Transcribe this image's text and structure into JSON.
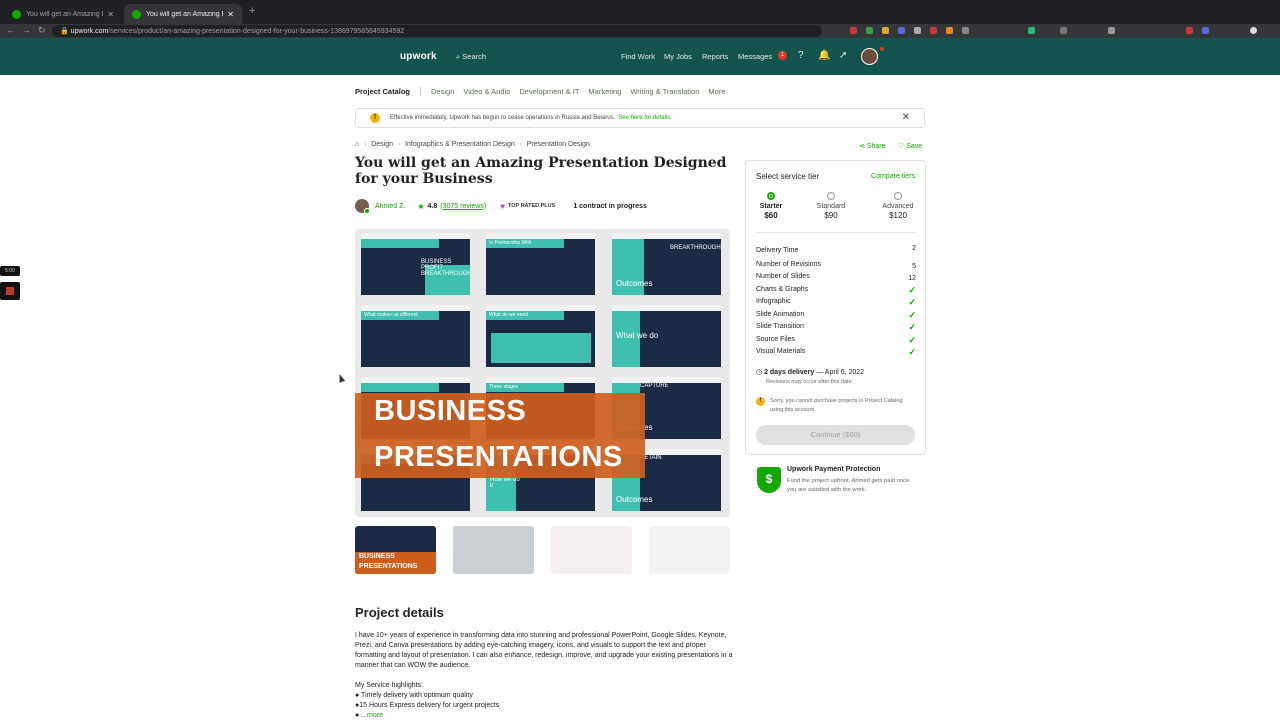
{
  "browser": {
    "tabs": [
      {
        "title": "You will get an Amazing Presentation"
      },
      {
        "title": "You will get an Amazing Presentation"
      }
    ],
    "url_domain": "upwork.com",
    "url_path": "/services/product/an-amazing-presentation-designed-for-your-business-1386979565645934592"
  },
  "header": {
    "logo": "upwork",
    "search": "Search",
    "nav": [
      "Find Work",
      "My Jobs",
      "Reports",
      "Messages"
    ],
    "messages_badge": "1"
  },
  "catnav": {
    "home": "Project Catalog",
    "items": [
      "Design",
      "Video & Audio",
      "Development & IT",
      "Marketing",
      "Writing & Translation",
      "More"
    ]
  },
  "alert": {
    "text": "Effective immediately, Upwork has begun to cease operations in Russia and Belarus.",
    "link": "See here for details."
  },
  "breadcrumb": [
    "Design",
    "Infographics & Presentation Design",
    "Presentation Design"
  ],
  "actions": {
    "share": "Share",
    "save": "Save"
  },
  "title": "You will get an Amazing Presentation Designed for your Business",
  "seller": {
    "name": "Ahmed Z.",
    "rating": "4.8",
    "reviews": "(3075 reviews)",
    "badge": "TOP RATED PLUS",
    "contracts": "1 contract in progress"
  },
  "gallery": {
    "overlay_line1": "BUSINESS",
    "overlay_line2": "PRESENTATIONS",
    "slides": [
      {
        "head": "",
        "caption": "BUSINESS PROFIT BREAKTHROUGH",
        "big": ""
      },
      {
        "head": "In Partnership With",
        "caption": "",
        "big": ""
      },
      {
        "head": "",
        "caption": "BREAKTHROUGH",
        "big": "Outcomes"
      },
      {
        "head": "What makes us different",
        "caption": "",
        "big": ""
      },
      {
        "head": "What do we need",
        "caption": "",
        "big": ""
      },
      {
        "head": "",
        "caption": "",
        "big": "What we do"
      },
      {
        "head": "",
        "caption": "",
        "big": ""
      },
      {
        "head": "Three stages",
        "caption": "",
        "big": ""
      },
      {
        "head": "CAPTURE",
        "caption": "",
        "big": "Outcomes"
      },
      {
        "head": "",
        "caption": "",
        "big": ""
      },
      {
        "head": "",
        "caption": "",
        "big": "How we do it"
      },
      {
        "head": "RETAIN",
        "caption": "",
        "big": "Outcomes"
      }
    ],
    "thumb_line1": "BUSINESS",
    "thumb_line2": "PRESENTATIONS"
  },
  "details": {
    "heading": "Project details",
    "body": "I have 10+ years of experience in transforming data into stunning and professional PowerPoint, Google Slides, Keynote, Prezi, and Canva presentations by adding eye-catching imagery, icons, and visuals to support the text and proper formatting and layout of presentation. I can also enhance, redesign, improve, and upgrade your existing presentations in a manner that can WOW the audience.",
    "highlights_title": "My Service highlights:",
    "highlights": [
      "● Timely delivery with optimum quality",
      "●15 Hours Express delivery for urgent projects",
      "● .."
    ],
    "more": "more"
  },
  "tiers_card": {
    "title": "Select service tier",
    "compare": "Compare tiers",
    "tiers": [
      {
        "name": "Starter",
        "price": "$60",
        "selected": true
      },
      {
        "name": "Standard",
        "price": "$90",
        "selected": false
      },
      {
        "name": "Advanced",
        "price": "$120",
        "selected": false
      }
    ],
    "features": [
      {
        "label": "Delivery Time",
        "value": "2"
      },
      {
        "label": "Number of Revisions",
        "value": "5"
      },
      {
        "label": "Number of Slides",
        "value": "12"
      },
      {
        "label": "Charts & Graphs",
        "value": "✓"
      },
      {
        "label": "Infographic",
        "value": "✓"
      },
      {
        "label": "Slide Animation",
        "value": "✓"
      },
      {
        "label": "Slide Transition",
        "value": "✓"
      },
      {
        "label": "Source Files",
        "value": "✓"
      },
      {
        "label": "Visual Materials",
        "value": "✓"
      }
    ],
    "delivery_bold": "2 days delivery",
    "delivery_date": " — April 6, 2022",
    "delivery_note": "Revisions may occur after this date.",
    "sorry": "Sorry, you cannot purchase projects in Project Catalog using this account.",
    "continue": "Continue ($60)"
  },
  "protection": {
    "title": "Upwork Payment Protection",
    "text": "Fund the project upfront. Ahmed gets paid once you are satisfied with the work."
  },
  "recorder": {
    "time": "5:00"
  },
  "colors": {
    "brand_green": "#14a800",
    "header_bg": "#13544e",
    "slide_navy": "#1c2b44",
    "slide_teal": "#3fbfae",
    "overlay_orange": "#ce5e1e"
  }
}
